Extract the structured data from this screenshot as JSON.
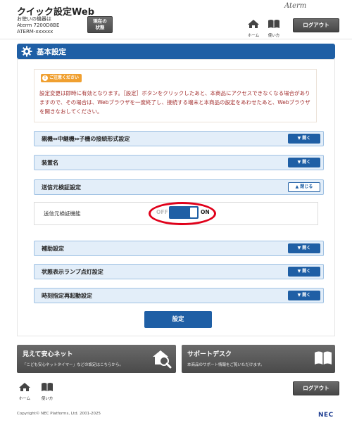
{
  "header": {
    "app_title": "クイック設定Web",
    "device_lines": [
      "お使いの機器は",
      "Aterm 7200D8BE",
      "ATERM-xxxxxx"
    ],
    "status_button": [
      "現在の",
      "状態"
    ],
    "brand": "Aterm",
    "home_label": "ホーム",
    "help_label": "使い方",
    "logout_label": "ログアウト"
  },
  "section": {
    "title": "基本設定"
  },
  "caution": {
    "badge": "ご注意ください",
    "text": "設定変更は即時に有効となります。［設定］ボタンをクリックしたあと、本商品にアクセスできなくなる場合がありますので、その場合は、Webブラウザを一度終了し、接続する端末と本商品の設定をあわせたあと、Webブラウザを開きなおしてください。"
  },
  "rows": {
    "connection": {
      "label": "親機⇔中継機⇔子機の接続形式設定",
      "button": "開く"
    },
    "device_name": {
      "label": "装置名",
      "button": "開く"
    },
    "sender_check": {
      "label": "送信元検証設定",
      "button": "閉じる"
    },
    "auxiliary": {
      "label": "補助設定",
      "button": "開く"
    },
    "lamp": {
      "label": "状態表示ランプ点灯設定",
      "button": "開く"
    },
    "reboot": {
      "label": "時刻指定再起動設定",
      "button": "開く"
    }
  },
  "expanded": {
    "label": "送信元検証機能",
    "off_text": "OFF",
    "on_text": "ON",
    "value": "ON"
  },
  "submit_label": "設定",
  "promos": {
    "safe_net": {
      "title": "見えて安心ネット",
      "subtitle": "「こども安心ネットタイマー」などの設定はこちらから。"
    },
    "support": {
      "title": "サポートデスク",
      "subtitle": "本商品のサポート情報をご覧いただけます。"
    }
  },
  "footer": {
    "home_label": "ホーム",
    "help_label": "使い方",
    "logout_label": "ログアウト",
    "copyright": "Copyright© NEC Platforms, Ltd. 2001-2025",
    "nec_logo": "NEC"
  },
  "colors": {
    "accent_blue": "#1f5fa5",
    "caution_orange": "#f0a030",
    "caution_text": "#a33030",
    "highlight_red": "#e0001a"
  }
}
